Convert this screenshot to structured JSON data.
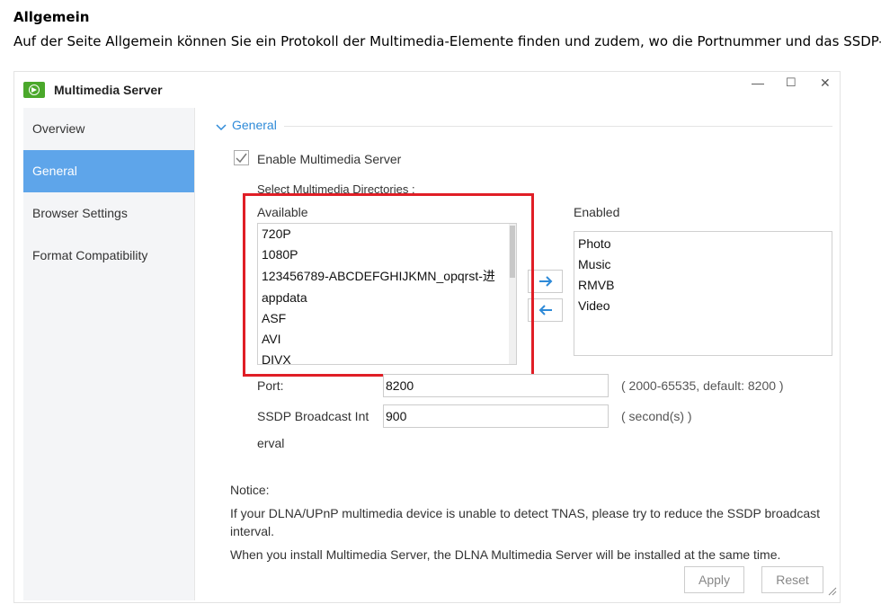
{
  "doc": {
    "heading": "Allgemein",
    "paragraph": "Auf der Seite Allgemein können Sie ein Protokoll der Multimedia-Elemente finden und zudem, wo die Portnummer und das SSDP-Üb"
  },
  "window": {
    "title": "Multimedia Server",
    "controls": {
      "minimize": "—",
      "maximize": "☐",
      "close": "✕"
    }
  },
  "sidebar": {
    "items": [
      {
        "label": "Overview",
        "active": false
      },
      {
        "label": "General",
        "active": true
      },
      {
        "label": "Browser Settings",
        "active": false
      },
      {
        "label": "Format Compatibility",
        "active": false
      }
    ]
  },
  "general": {
    "section_title": "General",
    "enable_label": "Enable Multimedia Server",
    "enable_checked": true,
    "select_dirs_label": "Select Multimedia Directories :",
    "available_label": "Available",
    "enabled_label": "Enabled",
    "available_items": [
      "720P",
      "1080P",
      "123456789-ABCDEFGHIJKMN_opqrst-进",
      "appdata",
      "ASF",
      "AVI",
      "DIVX"
    ],
    "enabled_items": [
      "Photo",
      "Music",
      "RMVB",
      "Video"
    ],
    "port_label": "Port:",
    "port_value": "8200",
    "port_hint": "( 2000-65535, default: 8200 )",
    "ssdp_label_1": "SSDP Broadcast Int",
    "ssdp_label_2": "erval",
    "ssdp_value": "900",
    "ssdp_hint": "( second(s) )",
    "notice_title": "Notice:",
    "notice_1a": "If your DLNA/UPnP multimedia device is unable to detect TNAS, please try to reduce the SSDP broadcast",
    "notice_1b": "interval.",
    "notice_2": "When you install Multimedia Server, the DLNA Multimedia Server will be installed at the same time.",
    "apply_label": "Apply",
    "reset_label": "Reset"
  },
  "colors": {
    "accent": "#5ea5ea",
    "highlight": "#e01e26",
    "app_icon": "#4aa82b",
    "link": "#2e8ad8"
  }
}
